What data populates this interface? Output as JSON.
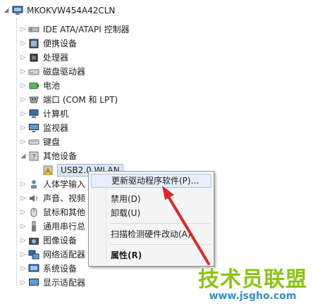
{
  "root": {
    "label": "MKOKVW454A42CLN",
    "icon": "computer-icon",
    "expander": "◢"
  },
  "categories": [
    {
      "label": "IDE ATA/ATAPI 控制器",
      "icon": "ide-controller-icon",
      "expander": "▷"
    },
    {
      "label": "便携设备",
      "icon": "portable-device-icon",
      "expander": "▷"
    },
    {
      "label": "处理器",
      "icon": "processor-icon",
      "expander": "▷"
    },
    {
      "label": "磁盘驱动器",
      "icon": "disk-drive-icon",
      "expander": "▷"
    },
    {
      "label": "电池",
      "icon": "battery-icon",
      "expander": "▷"
    },
    {
      "label": "端口 (COM 和 LPT)",
      "icon": "port-icon",
      "expander": "▷"
    },
    {
      "label": "计算机",
      "icon": "computer-small-icon",
      "expander": "▷"
    },
    {
      "label": "监视器",
      "icon": "monitor-icon",
      "expander": "▷"
    },
    {
      "label": "键盘",
      "icon": "keyboard-icon",
      "expander": "▷"
    },
    {
      "label": "其他设备",
      "icon": "unknown-device-icon",
      "expander": "◢"
    },
    {
      "label": "USB2.0 WLAN",
      "icon": "warning-device-icon",
      "expander": ""
    },
    {
      "label": "人体学输入",
      "icon": "hid-icon",
      "expander": "▷"
    },
    {
      "label": "声音、视频",
      "icon": "sound-icon",
      "expander": "▷"
    },
    {
      "label": "鼠标和其他",
      "icon": "mouse-icon",
      "expander": "▷"
    },
    {
      "label": "通用串行总",
      "icon": "usb-icon",
      "expander": "▷"
    },
    {
      "label": "图像设备",
      "icon": "camera-icon",
      "expander": "▷"
    },
    {
      "label": "网络适配器",
      "icon": "network-adapter-icon",
      "expander": "▷"
    },
    {
      "label": "系统设备",
      "icon": "system-device-icon",
      "expander": "▷"
    },
    {
      "label": "显示适配器",
      "icon": "display-adapter-icon",
      "expander": "▷"
    }
  ],
  "context_menu": {
    "update_driver": "更新驱动程序软件(P)...",
    "disable": "禁用(D)",
    "uninstall": "卸载(U)",
    "scan": "扫描检测硬件改动(A)",
    "properties": "属性(R)"
  },
  "watermark": {
    "title": "技术员联盟",
    "url": "www.jsgho.com"
  },
  "colors": {
    "selection": "#dbe8f7",
    "menu_highlight": "#e6eef9",
    "arrow": "#e0262b",
    "watermark_green": "#8bc414",
    "watermark_blue": "#2f8fc9"
  }
}
